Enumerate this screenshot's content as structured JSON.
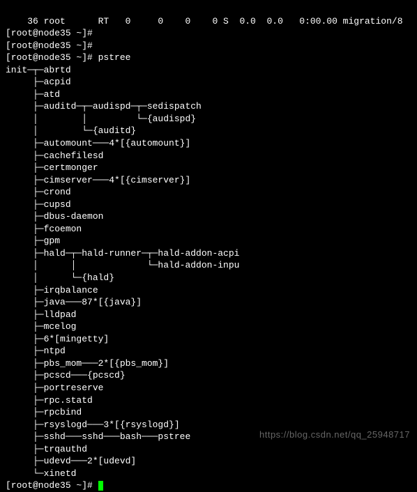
{
  "top_line": "    36 root      RT   0     0    0    0 S  0.0  0.0   0:00.00 migration/8",
  "prompts": {
    "p1": "[root@node35 ~]# ",
    "p2": "[root@node35 ~]# ",
    "p3": "[root@node35 ~]# ",
    "p4": "[root@node35 ~]# "
  },
  "command": "pstree",
  "tree": {
    "L01": "init─┬─abrtd",
    "L02": "     ├─acpid",
    "L03": "     ├─atd",
    "L04": "     ├─auditd─┬─audispd─┬─sedispatch",
    "L05": "     │        │         └─{audispd}",
    "L06": "     │        └─{auditd}",
    "L07": "     ├─automount───4*[{automount}]",
    "L08": "     ├─cachefilesd",
    "L09": "     ├─certmonger",
    "L10": "     ├─cimserver───4*[{cimserver}]",
    "L11": "     ├─crond",
    "L12": "     ├─cupsd",
    "L13": "     ├─dbus-daemon",
    "L14": "     ├─fcoemon",
    "L15": "     ├─gpm",
    "L16": "     ├─hald─┬─hald-runner─┬─hald-addon-acpi",
    "L17": "     │      │             └─hald-addon-inpu",
    "L18": "     │      └─{hald}",
    "L19": "     ├─irqbalance",
    "L20": "     ├─java───87*[{java}]",
    "L21": "     ├─lldpad",
    "L22": "     ├─mcelog",
    "L23": "     ├─6*[mingetty]",
    "L24": "     ├─ntpd",
    "L25": "     ├─pbs_mom───2*[{pbs_mom}]",
    "L26": "     ├─pcscd───{pcscd}",
    "L27": "     ├─portreserve",
    "L28": "     ├─rpc.statd",
    "L29": "     ├─rpcbind",
    "L30": "     ├─rsyslogd───3*[{rsyslogd}]",
    "L31": "     ├─sshd───sshd───bash───pstree",
    "L32": "     ├─trqauthd",
    "L33": "     ├─udevd───2*[udevd]",
    "L34": "     └─xinetd"
  },
  "watermark": "https://blog.csdn.net/qq_25948717"
}
